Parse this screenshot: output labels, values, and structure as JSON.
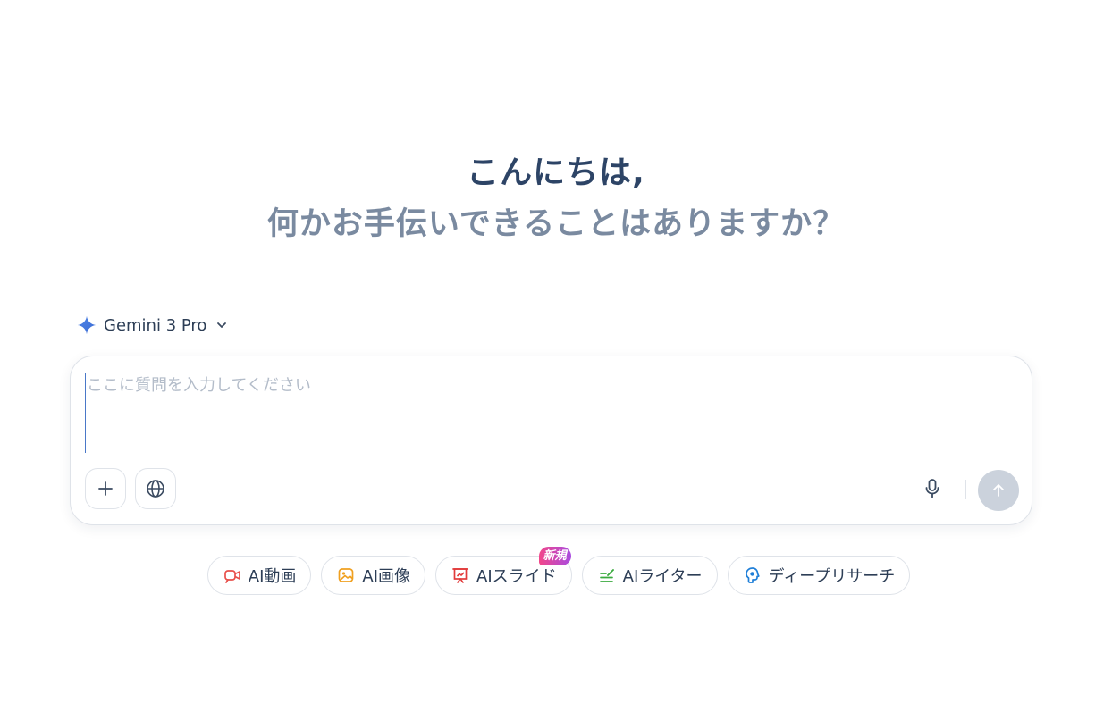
{
  "greeting": {
    "line1": "こんにちは,",
    "line2": "何かお手伝いできることはありますか？"
  },
  "model_selector": {
    "icon": "sparkle-icon",
    "name": "Gemini 3 Pro",
    "chevron": "chevron-down-icon"
  },
  "prompt": {
    "placeholder": "ここに質問を入力してください",
    "value": ""
  },
  "toolbar": {
    "add_icon": "plus-icon",
    "web_icon": "globe-icon",
    "mic_icon": "microphone-icon",
    "send_icon": "arrow-up-icon"
  },
  "chips": [
    {
      "label": "AI動画",
      "icon": "video-icon",
      "color": "#e8504b"
    },
    {
      "label": "AI画像",
      "icon": "image-icon",
      "color": "#f0a020"
    },
    {
      "label": "AIスライド",
      "icon": "presentation-icon",
      "color": "#e23b3b",
      "badge": "新規"
    },
    {
      "label": "AIライター",
      "icon": "pen-writer-icon",
      "color": "#3aaa3e"
    },
    {
      "label": "ディープリサーチ",
      "icon": "brain-icon",
      "color": "#1f7fd8"
    }
  ],
  "colors": {
    "accent": "#4a78c8",
    "send_disabled": "#cbd2dc",
    "badge_gradient_start": "#f2478a",
    "badge_gradient_end": "#a94be0"
  }
}
